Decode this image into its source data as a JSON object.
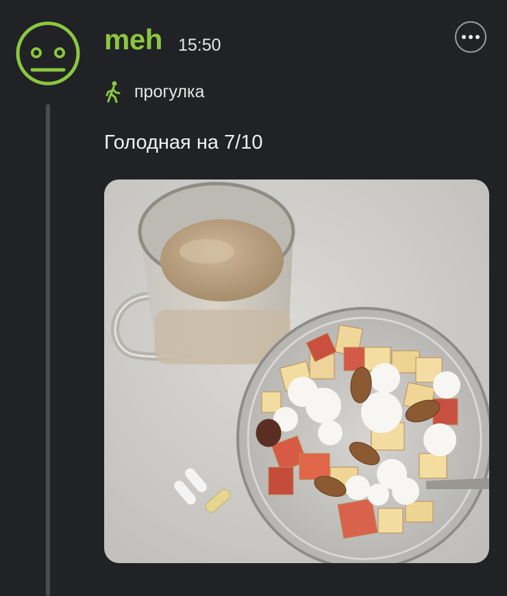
{
  "post": {
    "author": "meh",
    "time": "15:50",
    "activity": {
      "label": "прогулка",
      "icon": "walking-person-icon"
    },
    "text": "Голодная на 7/10",
    "photo": {
      "description_icon": "food-photo"
    },
    "menu_icon": "more-options-icon",
    "avatar_icon": "neutral-face-icon"
  },
  "colors": {
    "background": "#202226",
    "accent": "#8cc63f",
    "thread_line": "#4a4c51",
    "text": "#f2f2f2"
  }
}
